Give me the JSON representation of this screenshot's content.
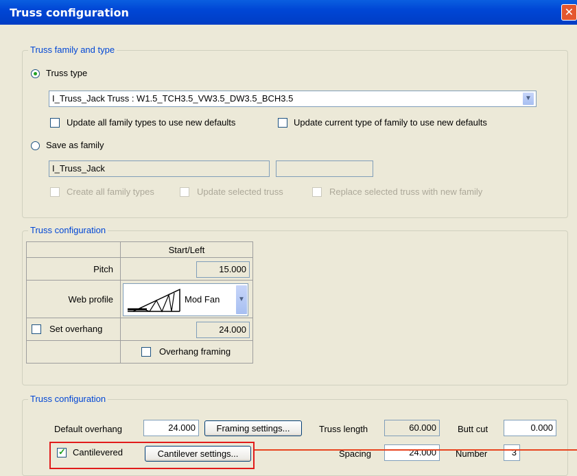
{
  "window": {
    "title": "Truss configuration"
  },
  "group1": {
    "legend": "Truss family and type",
    "truss_type_label": "Truss type",
    "truss_type_value": "I_Truss_Jack Truss : W1.5_TCH3.5_VW3.5_DW3.5_BCH3.5",
    "update_all_label": "Update all family types to use new defaults",
    "update_current_label": "Update current type of family to use new defaults",
    "save_as_family_label": "Save as family",
    "family_name_value": "I_Truss_Jack",
    "family_type_value": "",
    "create_all_label": "Create all family types",
    "update_selected_label": "Update selected truss",
    "replace_selected_label": "Replace selected truss with new family"
  },
  "group2": {
    "legend": "Truss configuration",
    "column_header": "Start/Left",
    "pitch_label": "Pitch",
    "pitch_value": "15.000",
    "web_profile_label": "Web profile",
    "web_profile_value": "Mod Fan",
    "set_overhang_label": "Set overhang",
    "overhang_value": "24.000",
    "overhang_framing_label": "Overhang framing"
  },
  "group3": {
    "legend": "Truss configuration",
    "default_overhang_label": "Default overhang",
    "default_overhang_value": "24.000",
    "framing_settings_label": "Framing settings...",
    "truss_length_label": "Truss length",
    "truss_length_value": "60.000",
    "butt_cut_label": "Butt cut",
    "butt_cut_value": "0.000",
    "cantilevered_label": "Cantilevered",
    "cantilever_settings_label": "Cantilever settings...",
    "spacing_label": "Spacing",
    "spacing_value": "24.000",
    "number_label": "Number",
    "number_value": "3"
  },
  "state": {
    "truss_type_selected": true,
    "save_as_family_selected": false,
    "cantilevered_checked": true
  },
  "colors": {
    "titlebar": "#0046d5",
    "highlight": "#e11a1a",
    "legend_text": "#0046d5"
  }
}
